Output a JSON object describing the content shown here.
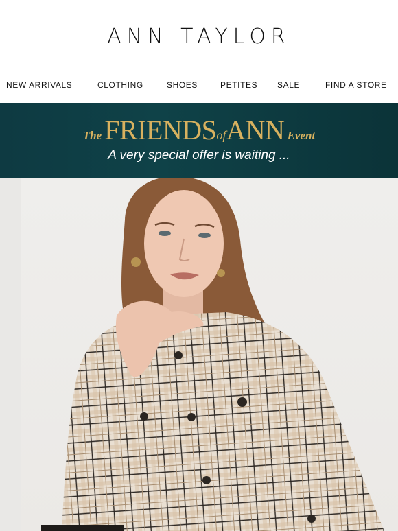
{
  "brand": {
    "name": "ANN TAYLOR"
  },
  "nav": {
    "items": [
      {
        "label": "NEW ARRIVALS"
      },
      {
        "label": "CLOTHING"
      },
      {
        "label": "SHOES"
      },
      {
        "label": "PETITES"
      },
      {
        "label": "SALE"
      },
      {
        "label": "FIND A STORE"
      }
    ]
  },
  "banner": {
    "the": "The",
    "friends": "FRIENDS",
    "of": "of",
    "ann": "ANN",
    "event": "Event",
    "subtitle": "A very special offer is waiting ..."
  },
  "colors": {
    "banner_bg": "#0f4248",
    "banner_gold": "#d7b15f",
    "text": "#111111"
  }
}
